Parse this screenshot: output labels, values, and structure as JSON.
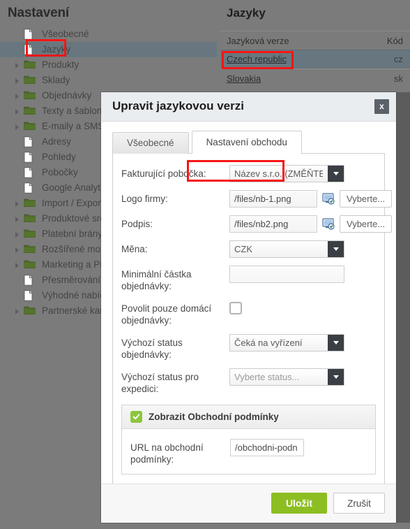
{
  "sidebar": {
    "title": "Nastavení",
    "items": [
      {
        "label": "Všeobecné",
        "icon": "file-icon",
        "expandable": false,
        "selected": false
      },
      {
        "label": "Jazyky",
        "icon": "file-icon",
        "expandable": false,
        "selected": true,
        "highlighted": true
      },
      {
        "label": "Produkty",
        "icon": "folder-icon",
        "expandable": true,
        "selected": false
      },
      {
        "label": "Sklady",
        "icon": "folder-icon",
        "expandable": true,
        "selected": false
      },
      {
        "label": "Objednávky",
        "icon": "folder-icon",
        "expandable": true,
        "selected": false
      },
      {
        "label": "Texty a šablony",
        "icon": "folder-icon",
        "expandable": true,
        "selected": false
      },
      {
        "label": "E-maily a SMS",
        "icon": "folder-icon",
        "expandable": true,
        "selected": false
      },
      {
        "label": "Adresy",
        "icon": "file-icon",
        "expandable": false,
        "selected": false
      },
      {
        "label": "Pohledy",
        "icon": "file-icon",
        "expandable": false,
        "selected": false
      },
      {
        "label": "Pobočky",
        "icon": "file-icon",
        "expandable": false,
        "selected": false
      },
      {
        "label": "Google Analytics",
        "icon": "file-icon",
        "expandable": false,
        "selected": false
      },
      {
        "label": "Import / Export",
        "icon": "folder-icon",
        "expandable": true,
        "selected": false
      },
      {
        "label": "Produktové srov",
        "icon": "folder-icon",
        "expandable": true,
        "selected": false
      },
      {
        "label": "Platební brány",
        "icon": "folder-icon",
        "expandable": true,
        "selected": false
      },
      {
        "label": "Rozšířené možno",
        "icon": "folder-icon",
        "expandable": true,
        "selected": false
      },
      {
        "label": "Marketing a PPC",
        "icon": "folder-icon",
        "expandable": true,
        "selected": false
      },
      {
        "label": "Přesměrování UR",
        "icon": "file-icon",
        "expandable": false,
        "selected": false
      },
      {
        "label": "Výhodné nabídky",
        "icon": "file-icon",
        "expandable": false,
        "selected": false
      },
      {
        "label": "Partnerské karty",
        "icon": "folder-icon",
        "expandable": true,
        "selected": false
      }
    ]
  },
  "right_panel": {
    "title": "Jazyky",
    "columns": {
      "name": "Jazyková verze",
      "code": "Kód"
    },
    "rows": [
      {
        "name": "Czech republic",
        "code": "cz",
        "selected": true,
        "highlighted": true
      },
      {
        "name": "Slovakia",
        "code": "sk",
        "selected": false,
        "highlighted": false
      }
    ]
  },
  "dialog": {
    "title": "Upravit jazykovou verzi",
    "close_label": "x",
    "tabs": [
      {
        "label": "Všeobecné",
        "active": false,
        "highlighted": false
      },
      {
        "label": "Nastavení obchodu",
        "active": true,
        "highlighted": true
      }
    ],
    "fields": {
      "billing_branch": {
        "label": "Fakturující pobočka:",
        "value": "Název s.r.o. (ZMĚŇTE)"
      },
      "company_logo": {
        "label": "Logo firmy:",
        "value": "/files/nb-1.png",
        "browse_label": "Vyberte..."
      },
      "signature": {
        "label": "Podpis:",
        "value": "/files/nb2.png",
        "browse_label": "Vyberte..."
      },
      "currency": {
        "label": "Měna:",
        "value": "CZK"
      },
      "min_order_amount": {
        "label": "Minimální částka objednávky:",
        "value": "",
        "placeholder": ""
      },
      "domestic_only": {
        "label": "Povolit pouze domácí objednávky:",
        "checked": false
      },
      "default_order_status": {
        "label": "Výchozí status objednávky:",
        "value": "Čeká na vyřízení"
      },
      "default_shipping_status": {
        "label": "Výchozí status pro expedici:",
        "value": "Vyberte status..."
      }
    },
    "terms_panel": {
      "title": "Zobrazit Obchodní podmínky",
      "checked": true,
      "url_field": {
        "label": "URL na obchodní podmínky:",
        "value": "/obchodni-podn"
      }
    },
    "footer": {
      "save_label": "Uložit",
      "cancel_label": "Zrušit"
    }
  },
  "colors": {
    "page_background": "#7b7b7b",
    "selection": "#68777f",
    "highlight_box": "#f61616",
    "save_button": "#8cbe22",
    "checkbox_green": "#8cc63e",
    "folder_green": "#4e6b28"
  }
}
